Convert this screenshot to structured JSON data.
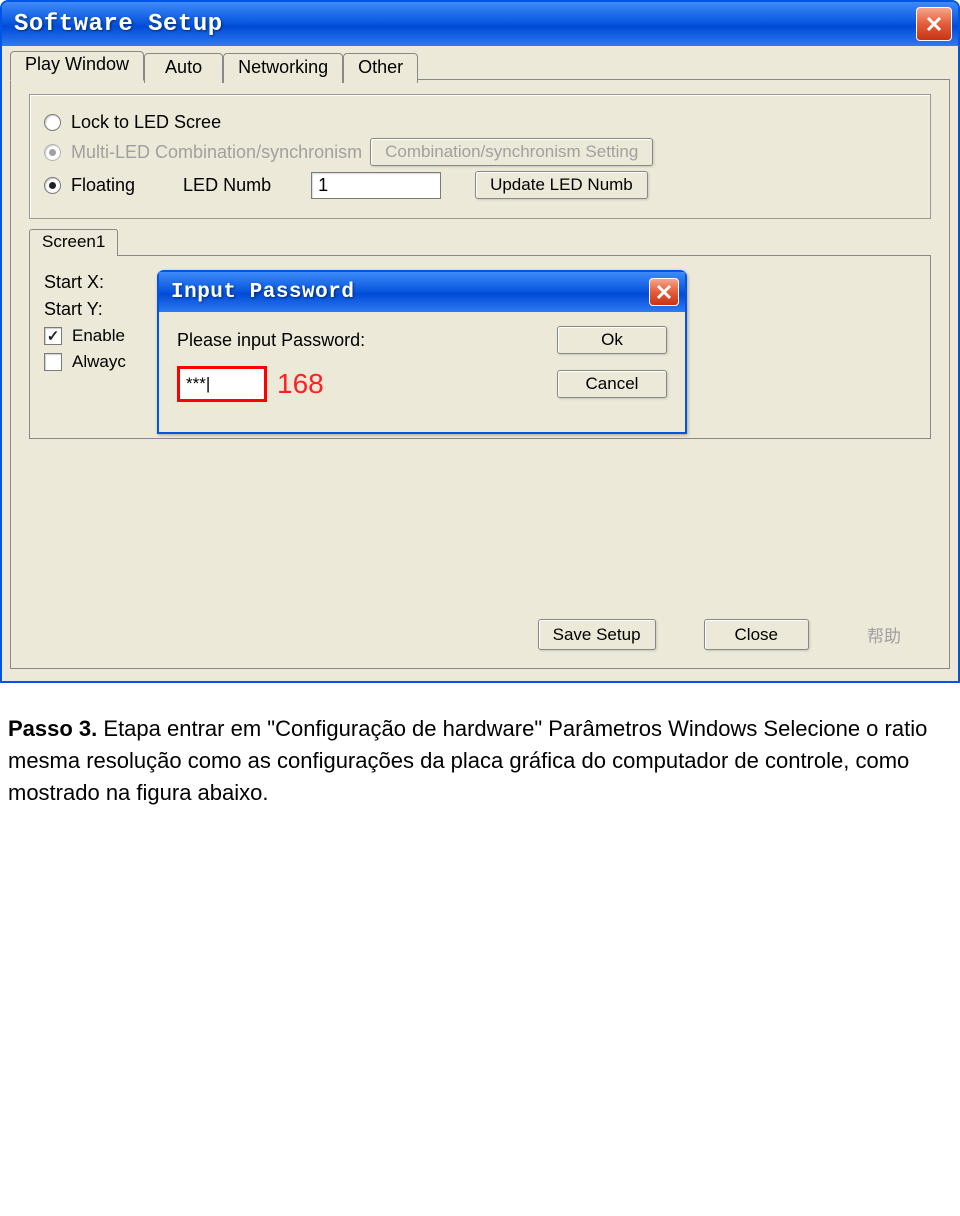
{
  "mainWindow": {
    "title": "Software Setup",
    "tabs": [
      "Play Window",
      "Auto",
      "Networking",
      "Other"
    ],
    "activeTab": 0,
    "radios": {
      "lockLed": "Lock to LED Scree",
      "multiLed": "Multi-LED Combination/synchronism",
      "floating": "Floating"
    },
    "combSyncBtn": "Combination/synchronism Setting",
    "ledNumbLabel": "LED Numb",
    "ledNumbValue": "1",
    "updateLedBtn": "Update LED Numb",
    "subTab": "Screen1",
    "startXLabel": "Start X:",
    "startYLabel": "Start Y:",
    "enableLabel": "Enable",
    "alwaysLabel": "Alwayc",
    "saveBtn": "Save Setup",
    "closeBtn": "Close",
    "helpBtn": "帮助"
  },
  "modal": {
    "title": "Input Password",
    "prompt": "Please input Password:",
    "okBtn": "Ok",
    "cancelBtn": "Cancel",
    "pwValue": "***|",
    "pwHint": "168"
  },
  "doc": {
    "step": "Passo 3.",
    "text": " Etapa entrar em \"Configuração de hardware\" Parâmetros Windows Selecione o ratio mesma resolução como as configurações da placa gráfica do computador de controle, como mostrado na figura abaixo."
  }
}
